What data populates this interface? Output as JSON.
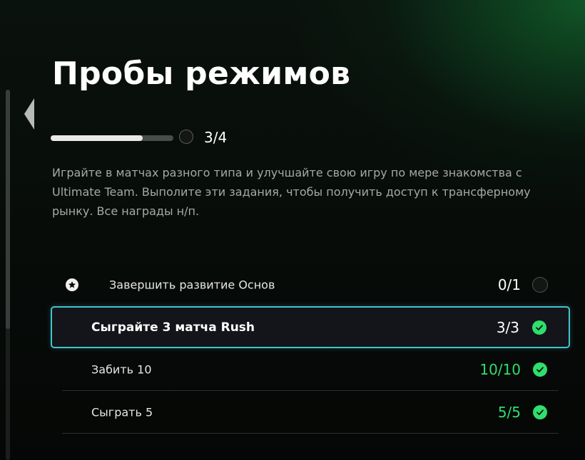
{
  "page": {
    "title": "Пробы режимов",
    "progress": {
      "text": "3/4",
      "value_fraction": 0.75
    },
    "description": "Играйте в матчах разного типа и улучшайте свою игру по мере знакомства с Ultimate Team. Выполите эти задания, чтобы получить доступ к трансферному рынку. Все награды н/п."
  },
  "tasks": [
    {
      "label": "Завершить развитие Основ",
      "count": "0/1",
      "status": "incomplete",
      "icon": "star-badge-icon"
    },
    {
      "label": "Сыграйте 3 матча Rush",
      "count": "3/3",
      "status": "complete",
      "selected": true
    },
    {
      "label": "Забить 10",
      "count": "10/10",
      "status": "complete"
    },
    {
      "label": "Сыграть 5",
      "count": "5/5",
      "status": "complete"
    }
  ],
  "colors": {
    "accent_green": "#2fde6c",
    "selection_border": "#43c3cf",
    "muted_text": "#a6a9a7"
  }
}
